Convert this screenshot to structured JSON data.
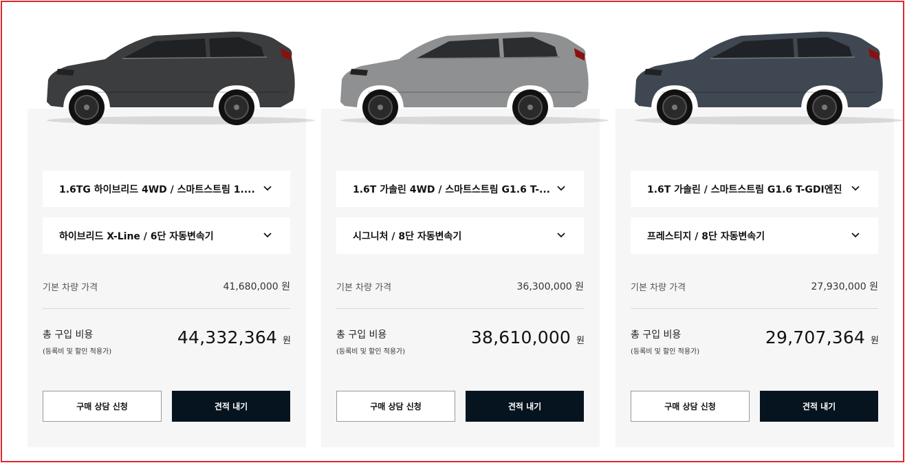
{
  "cards": [
    {
      "car_color": "#3b3d3f",
      "trim_label": "1.6TG 하이브리드 4WD / 스마트스트림 1....",
      "grade_label": "하이브리드 X-Line / 6단 자동변속기",
      "base_price_label": "기본 차량 가격",
      "base_price_value": "41,680,000 원",
      "total_label": "총 구입 비용",
      "total_note": "(등록비 및 할인 적용가)",
      "total_value": "44,332,364",
      "currency": "원",
      "consult_button": "구매 상담 신청",
      "quote_button": "견적 내기"
    },
    {
      "car_color": "#8e9091",
      "trim_label": "1.6T 가솔린 4WD / 스마트스트림 G1.6 T-...",
      "grade_label": "시그니처 / 8단 자동변속기",
      "base_price_label": "기본 차량 가격",
      "base_price_value": "36,300,000 원",
      "total_label": "총 구입 비용",
      "total_note": "(등록비 및 할인 적용가)",
      "total_value": "38,610,000",
      "currency": "원",
      "consult_button": "구매 상담 신청",
      "quote_button": "견적 내기"
    },
    {
      "car_color": "#3f4852",
      "trim_label": "1.6T 가솔린 / 스마트스트림 G1.6 T-GDI엔진",
      "grade_label": "프레스티지 / 8단 자동변속기",
      "base_price_label": "기본 차량 가격",
      "base_price_value": "27,930,000 원",
      "total_label": "총 구입 비용",
      "total_note": "(등록비 및 할인 적용가)",
      "total_value": "29,707,364",
      "currency": "원",
      "consult_button": "구매 상담 신청",
      "quote_button": "견적 내기"
    }
  ],
  "colors": {
    "accent_dark": "#05141f",
    "frame_red": "#e0262b",
    "card_bg": "#f6f6f6"
  },
  "icons": {
    "dropdown": "chevron-down-icon",
    "car": "car-image"
  }
}
